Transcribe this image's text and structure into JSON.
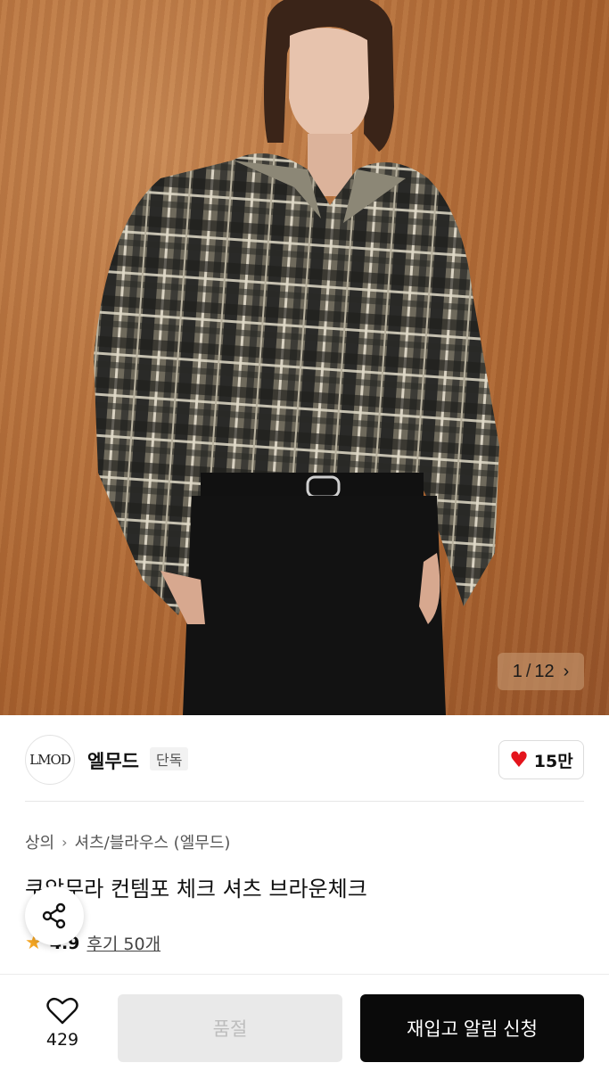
{
  "gallery": {
    "current": "1",
    "separator": "/",
    "total": "12",
    "next_glyph": "›"
  },
  "brand": {
    "logo_text": "LMOD",
    "name": "엘무드",
    "exclusive_badge": "단독",
    "likes_count": "15만",
    "accent_color": "#e4141c"
  },
  "product": {
    "breadcrumb": [
      "상의",
      "셔츠/블라우스 (엘무드)"
    ],
    "breadcrumb_sep": "›",
    "title": "쿠앙무라 컨템포 체크 셔츠 브라운체크",
    "rating": "4.9",
    "reviews_label": "후기 50개"
  },
  "icons": {
    "share": "share-icon",
    "star": "star-icon",
    "heart": "heart-outline-icon",
    "like": "heart-filled-icon",
    "chevron": "chevron-right-icon"
  },
  "bottom_bar": {
    "wishlist_count": "429",
    "soldout_label": "품절",
    "notify_label": "재입고 알림 신청"
  }
}
